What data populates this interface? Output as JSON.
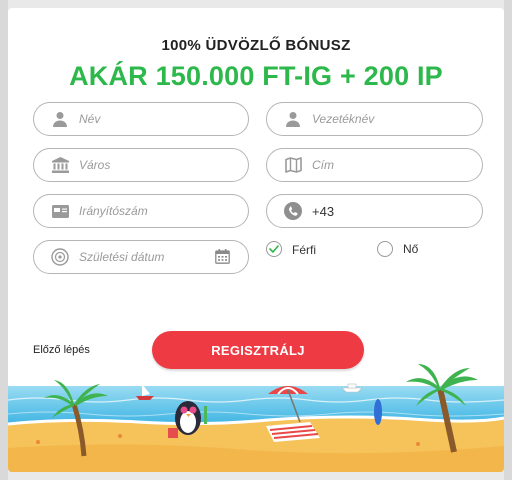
{
  "header": {
    "subtitle": "100% ÜDVÖZLŐ BÓNUSZ",
    "headline": "AKÁR 150.000 FT-IG + 200 IP"
  },
  "form": {
    "first_name": {
      "placeholder": "Név",
      "icon": "person-icon"
    },
    "last_name": {
      "placeholder": "Vezetéknév",
      "icon": "person-icon"
    },
    "city": {
      "placeholder": "Város",
      "icon": "building-icon"
    },
    "address": {
      "placeholder": "Cím",
      "icon": "map-icon"
    },
    "zip": {
      "placeholder": "Irányítószám",
      "icon": "card-icon"
    },
    "phone": {
      "value": "+43",
      "icon": "phone-icon"
    },
    "birthdate": {
      "placeholder": "Születési dátum",
      "icon": "cake-icon"
    },
    "gender": {
      "male_label": "Férfi",
      "female_label": "Nő",
      "selected": "Férfi"
    }
  },
  "actions": {
    "prev_label": "Előző lépés",
    "register_label": "REGISZTRÁLJ"
  },
  "colors": {
    "accent_green": "#2db84b",
    "button_red": "#ee3a43"
  }
}
